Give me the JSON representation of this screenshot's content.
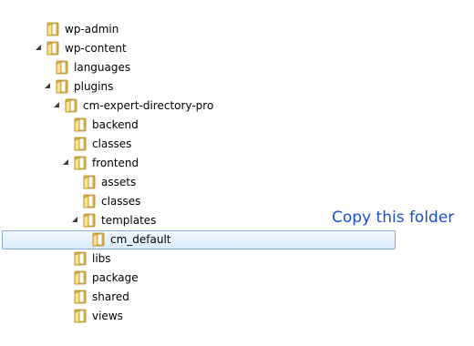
{
  "tree": {
    "items": [
      {
        "label": "wp-admin",
        "depth": 0,
        "expanded": false,
        "has_children": false,
        "selected": false
      },
      {
        "label": "wp-content",
        "depth": 0,
        "expanded": true,
        "has_children": true,
        "selected": false
      },
      {
        "label": "languages",
        "depth": 1,
        "expanded": false,
        "has_children": false,
        "selected": false
      },
      {
        "label": "plugins",
        "depth": 1,
        "expanded": true,
        "has_children": true,
        "selected": false
      },
      {
        "label": "cm-expert-directory-pro",
        "depth": 2,
        "expanded": true,
        "has_children": true,
        "selected": false
      },
      {
        "label": "backend",
        "depth": 3,
        "expanded": false,
        "has_children": false,
        "selected": false
      },
      {
        "label": "classes",
        "depth": 3,
        "expanded": false,
        "has_children": false,
        "selected": false
      },
      {
        "label": "frontend",
        "depth": 3,
        "expanded": true,
        "has_children": true,
        "selected": false
      },
      {
        "label": "assets",
        "depth": 4,
        "expanded": false,
        "has_children": false,
        "selected": false
      },
      {
        "label": "classes",
        "depth": 4,
        "expanded": false,
        "has_children": false,
        "selected": false
      },
      {
        "label": "templates",
        "depth": 4,
        "expanded": true,
        "has_children": true,
        "selected": false
      },
      {
        "label": "cm_default",
        "depth": 5,
        "expanded": false,
        "has_children": false,
        "selected": true
      },
      {
        "label": "libs",
        "depth": 3,
        "expanded": false,
        "has_children": false,
        "selected": false
      },
      {
        "label": "package",
        "depth": 3,
        "expanded": false,
        "has_children": false,
        "selected": false
      },
      {
        "label": "shared",
        "depth": 3,
        "expanded": false,
        "has_children": false,
        "selected": false
      },
      {
        "label": "views",
        "depth": 3,
        "expanded": false,
        "has_children": false,
        "selected": false
      }
    ]
  },
  "annotation": {
    "text": "Copy this folder",
    "color": "#1a4fd0"
  },
  "icons": {
    "folder": "folder-icon",
    "expanded_arrow": "expanded-arrow-icon"
  },
  "colors": {
    "folder_front": "#f3d57a",
    "folder_back": "#d9ac3c",
    "selection_border": "#84acdd",
    "selection_fill": "#dbecfc"
  }
}
